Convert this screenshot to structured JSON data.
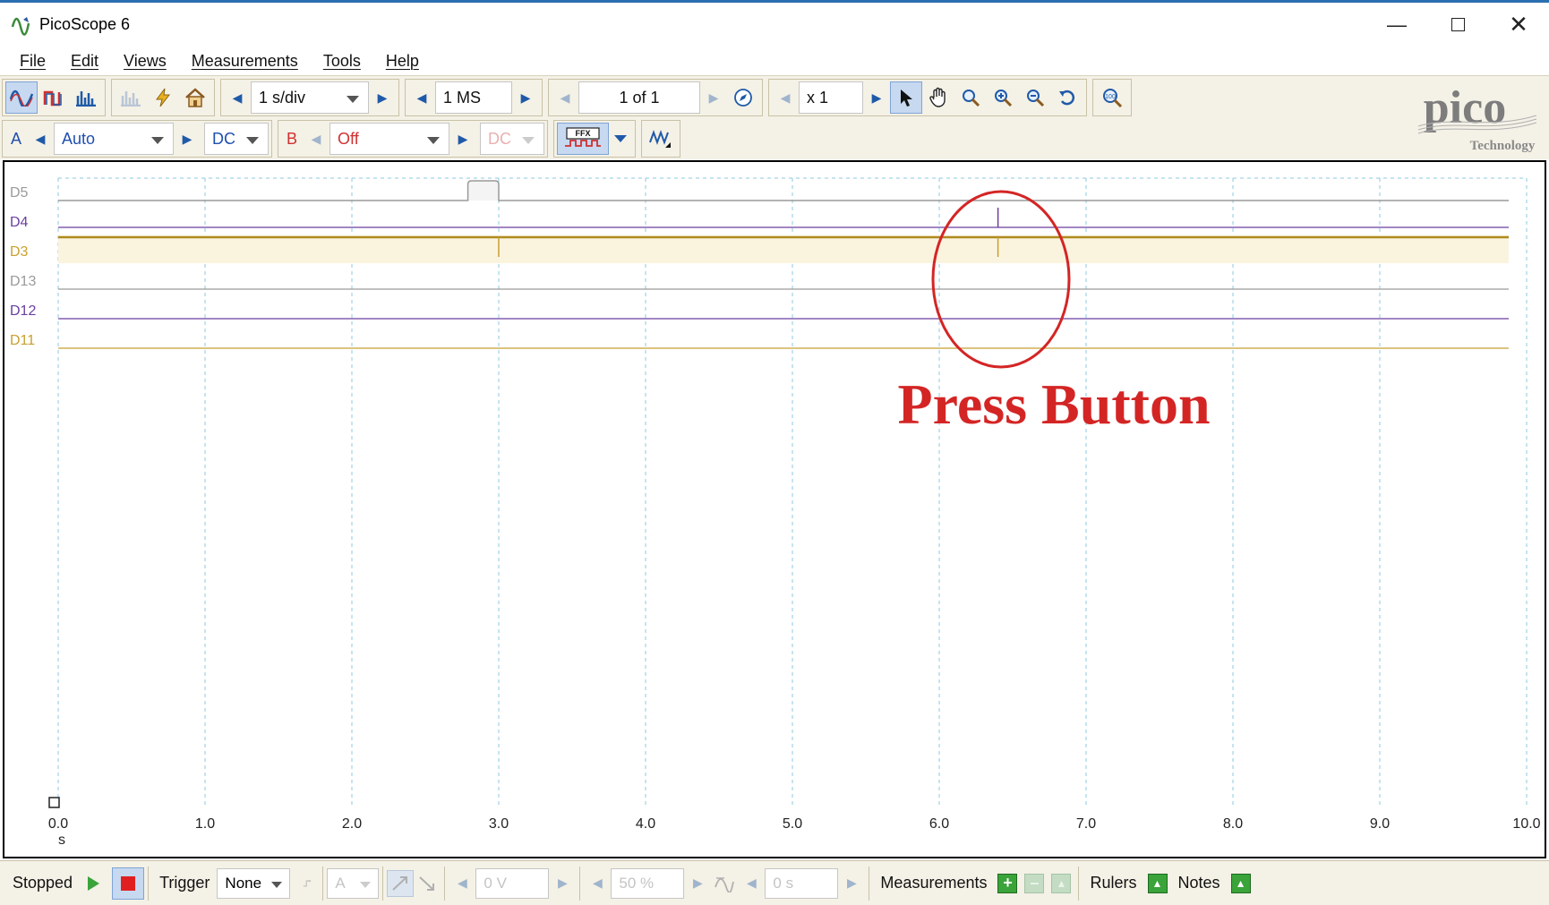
{
  "window": {
    "title": "PicoScope 6"
  },
  "menu": [
    "File",
    "Edit",
    "Views",
    "Measurements",
    "Tools",
    "Help"
  ],
  "toolbar": {
    "timebase": "1 s/div",
    "samples": "1 MS",
    "buffer": "1 of 1",
    "zoom": "x 1"
  },
  "channels": {
    "a_label": "A",
    "a_range": "Auto",
    "a_coupling": "DC",
    "b_label": "B",
    "b_range": "Off",
    "b_coupling": "DC"
  },
  "logo": {
    "text": "pico",
    "subtext": "Technology"
  },
  "scope": {
    "x_ticks": [
      "0.0",
      "1.0",
      "2.0",
      "3.0",
      "4.0",
      "5.0",
      "6.0",
      "7.0",
      "8.0",
      "9.0",
      "10.0"
    ],
    "x_unit": "s",
    "channels": [
      {
        "label": "D5",
        "color": "#9a9a9a"
      },
      {
        "label": "D4",
        "color": "#6a3fa0"
      },
      {
        "label": "D3",
        "color": "#c8a030"
      },
      {
        "label": "D13",
        "color": "#9a9a9a"
      },
      {
        "label": "D12",
        "color": "#6a3fa0"
      },
      {
        "label": "D11",
        "color": "#c8a030"
      }
    ],
    "annotation": "Press Button",
    "annotation_color": "#d42525"
  },
  "status": {
    "state": "Stopped",
    "trigger_label": "Trigger",
    "trigger_mode": "None",
    "trigger_channel": "A",
    "threshold": "0 V",
    "pre_trigger": "50 %",
    "delay": "0 s",
    "measurements": "Measurements",
    "rulers": "Rulers",
    "notes": "Notes"
  },
  "colors": {
    "accent_blue": "#1f5aa8",
    "panel": "#f4f1e6",
    "grid": "#8cc9e0"
  }
}
